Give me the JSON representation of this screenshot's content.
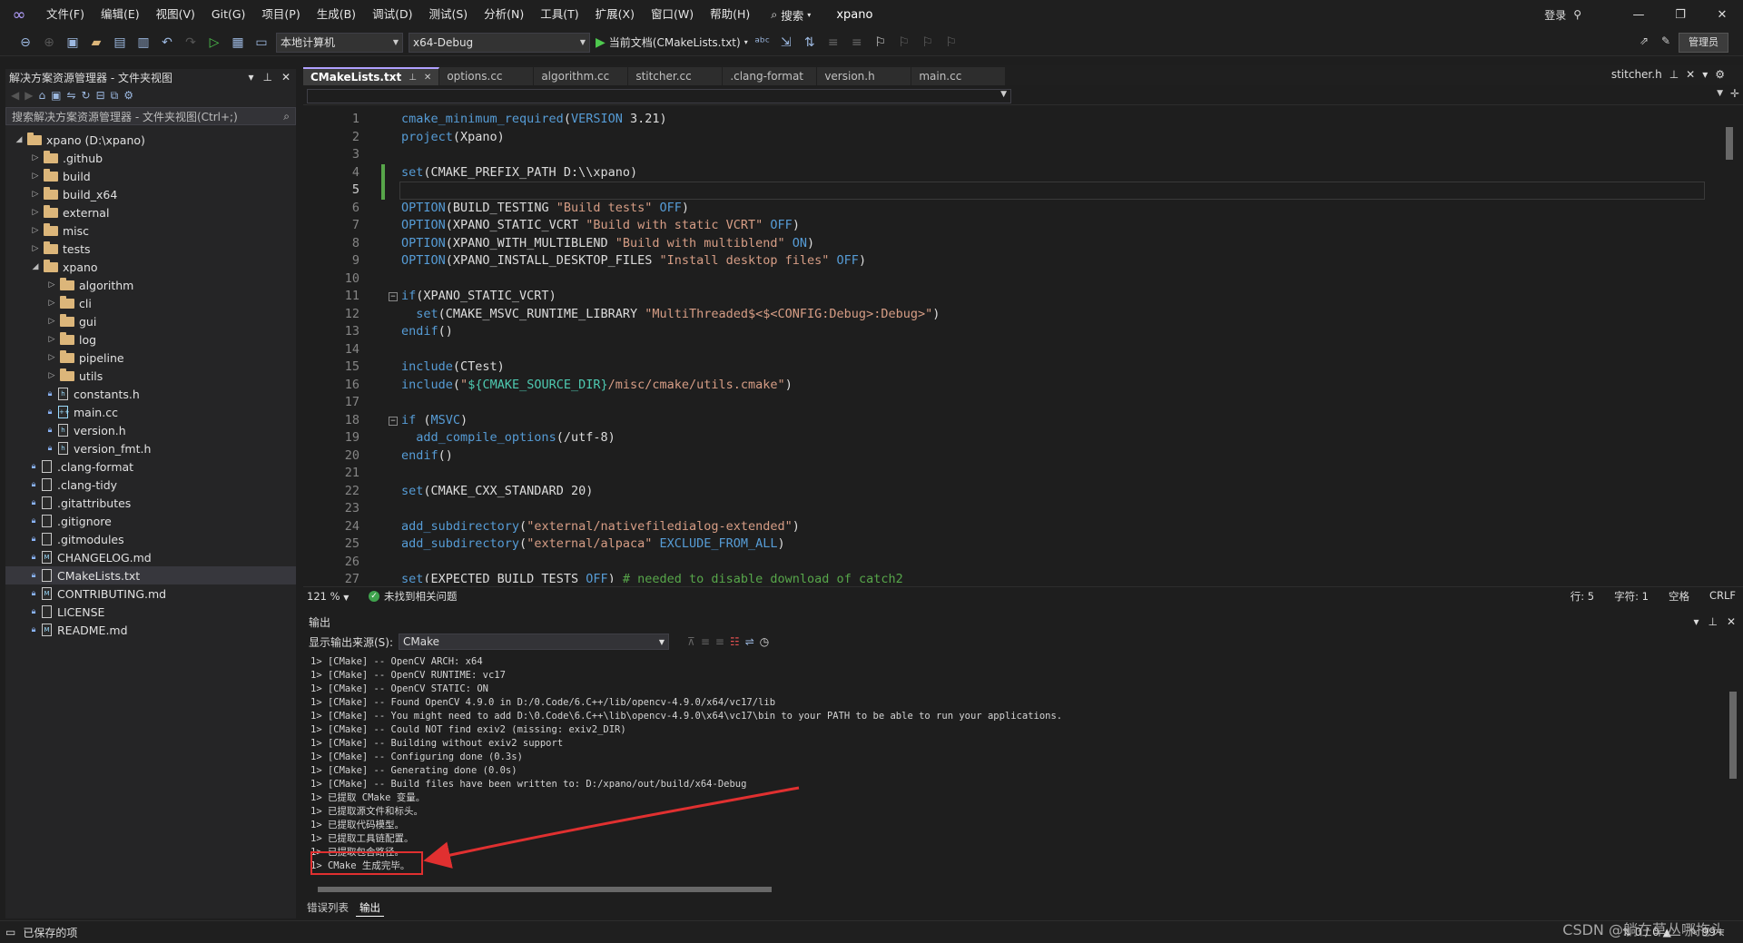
{
  "app": {
    "title": "xpano",
    "login": "登录",
    "admin": "管理员"
  },
  "menu": [
    "文件(F)",
    "编辑(E)",
    "视图(V)",
    "Git(G)",
    "项目(P)",
    "生成(B)",
    "调试(D)",
    "测试(S)",
    "分析(N)",
    "工具(T)",
    "扩展(X)",
    "窗口(W)",
    "帮助(H)"
  ],
  "search_label": "搜索",
  "toolbar": {
    "target": "本地计算机",
    "config": "x64-Debug",
    "run": "当前文档(CMakeLists.txt)"
  },
  "solution": {
    "title": "解决方案资源管理器 - 文件夹视图",
    "search_placeholder": "搜索解决方案资源管理器 - 文件夹视图(Ctrl+;)",
    "items": [
      {
        "label": "xpano (D:\\xpano)",
        "depth": 0,
        "type": "folder",
        "open": true
      },
      {
        "label": ".github",
        "depth": 1,
        "type": "folder"
      },
      {
        "label": "build",
        "depth": 1,
        "type": "folder"
      },
      {
        "label": "build_x64",
        "depth": 1,
        "type": "folder"
      },
      {
        "label": "external",
        "depth": 1,
        "type": "folder"
      },
      {
        "label": "misc",
        "depth": 1,
        "type": "folder"
      },
      {
        "label": "tests",
        "depth": 1,
        "type": "folder"
      },
      {
        "label": "xpano",
        "depth": 1,
        "type": "folder",
        "open": true
      },
      {
        "label": "algorithm",
        "depth": 2,
        "type": "folder"
      },
      {
        "label": "cli",
        "depth": 2,
        "type": "folder"
      },
      {
        "label": "gui",
        "depth": 2,
        "type": "folder"
      },
      {
        "label": "log",
        "depth": 2,
        "type": "folder"
      },
      {
        "label": "pipeline",
        "depth": 2,
        "type": "folder"
      },
      {
        "label": "utils",
        "depth": 2,
        "type": "folder"
      },
      {
        "label": "constants.h",
        "depth": 2,
        "type": "h"
      },
      {
        "label": "main.cc",
        "depth": 2,
        "type": "cc"
      },
      {
        "label": "version.h",
        "depth": 2,
        "type": "h"
      },
      {
        "label": "version_fmt.h",
        "depth": 2,
        "type": "h"
      },
      {
        "label": ".clang-format",
        "depth": 1,
        "type": "file"
      },
      {
        "label": ".clang-tidy",
        "depth": 1,
        "type": "file"
      },
      {
        "label": ".gitattributes",
        "depth": 1,
        "type": "file"
      },
      {
        "label": ".gitignore",
        "depth": 1,
        "type": "file"
      },
      {
        "label": ".gitmodules",
        "depth": 1,
        "type": "file"
      },
      {
        "label": "CHANGELOG.md",
        "depth": 1,
        "type": "md"
      },
      {
        "label": "CMakeLists.txt",
        "depth": 1,
        "type": "file",
        "selected": true
      },
      {
        "label": "CONTRIBUTING.md",
        "depth": 1,
        "type": "md"
      },
      {
        "label": "LICENSE",
        "depth": 1,
        "type": "file"
      },
      {
        "label": "README.md",
        "depth": 1,
        "type": "md"
      }
    ]
  },
  "editor": {
    "tabs": [
      "CMakeLists.txt",
      "options.cc",
      "algorithm.cc",
      "stitcher.cc",
      ".clang-format",
      "version.h",
      "main.cc"
    ],
    "right_tab": "stitcher.h",
    "current_line": 5,
    "lines": [
      {
        "n": 1,
        "parts": [
          [
            "cmd",
            "cmake_minimum_required"
          ],
          [
            "v",
            "("
          ],
          [
            "k",
            "VERSION"
          ],
          [
            "v",
            " 3.21)"
          ]
        ]
      },
      {
        "n": 2,
        "parts": [
          [
            "cmd",
            "project"
          ],
          [
            "v",
            "(Xpano)"
          ]
        ]
      },
      {
        "n": 3,
        "parts": []
      },
      {
        "n": 4,
        "parts": [
          [
            "cmd",
            "set"
          ],
          [
            "v",
            "(CMAKE_PREFIX_PATH D:\\\\xpano)"
          ]
        ]
      },
      {
        "n": 5,
        "parts": []
      },
      {
        "n": 6,
        "parts": [
          [
            "cmd",
            "OPTION"
          ],
          [
            "v",
            "(BUILD_TESTING "
          ],
          [
            "s",
            "\"Build tests\""
          ],
          [
            "k",
            " OFF"
          ],
          [
            "v",
            ")"
          ]
        ]
      },
      {
        "n": 7,
        "parts": [
          [
            "cmd",
            "OPTION"
          ],
          [
            "v",
            "(XPANO_STATIC_VCRT "
          ],
          [
            "s",
            "\"Build with static VCRT\""
          ],
          [
            "k",
            " OFF"
          ],
          [
            "v",
            ")"
          ]
        ]
      },
      {
        "n": 8,
        "parts": [
          [
            "cmd",
            "OPTION"
          ],
          [
            "v",
            "(XPANO_WITH_MULTIBLEND "
          ],
          [
            "s",
            "\"Build with multiblend\""
          ],
          [
            "k",
            " ON"
          ],
          [
            "v",
            ")"
          ]
        ]
      },
      {
        "n": 9,
        "parts": [
          [
            "cmd",
            "OPTION"
          ],
          [
            "v",
            "(XPANO_INSTALL_DESKTOP_FILES "
          ],
          [
            "s",
            "\"Install desktop files\""
          ],
          [
            "k",
            " OFF"
          ],
          [
            "v",
            ")"
          ]
        ]
      },
      {
        "n": 10,
        "parts": []
      },
      {
        "n": 11,
        "parts": [
          [
            "cmd",
            "if"
          ],
          [
            "v",
            "(XPANO_STATIC_VCRT)"
          ]
        ],
        "fold": true
      },
      {
        "n": 12,
        "parts": [
          [
            "v",
            "  "
          ],
          [
            "cmd",
            "set"
          ],
          [
            "v",
            "(CMAKE_MSVC_RUNTIME_LIBRARY "
          ],
          [
            "s",
            "\"MultiThreaded$<$<CONFIG:Debug>:Debug>\""
          ],
          [
            "v",
            ")"
          ]
        ]
      },
      {
        "n": 13,
        "parts": [
          [
            "cmd",
            "endif"
          ],
          [
            "v",
            "()"
          ]
        ]
      },
      {
        "n": 14,
        "parts": []
      },
      {
        "n": 15,
        "parts": [
          [
            "cmd",
            "include"
          ],
          [
            "v",
            "(CTest)"
          ]
        ]
      },
      {
        "n": 16,
        "parts": [
          [
            "cmd",
            "include"
          ],
          [
            "v",
            "("
          ],
          [
            "s",
            "\""
          ],
          [
            "var",
            "${CMAKE_SOURCE_DIR}"
          ],
          [
            "s",
            "/misc/cmake/utils.cmake\""
          ],
          [
            "v",
            ")"
          ]
        ]
      },
      {
        "n": 17,
        "parts": []
      },
      {
        "n": 18,
        "parts": [
          [
            "cmd",
            "if"
          ],
          [
            "v",
            " ("
          ],
          [
            "k",
            "MSVC"
          ],
          [
            "v",
            ")"
          ]
        ],
        "fold": true
      },
      {
        "n": 19,
        "parts": [
          [
            "v",
            "  "
          ],
          [
            "cmd",
            "add_compile_options"
          ],
          [
            "v",
            "(/utf-8)"
          ]
        ]
      },
      {
        "n": 20,
        "parts": [
          [
            "cmd",
            "endif"
          ],
          [
            "v",
            "()"
          ]
        ]
      },
      {
        "n": 21,
        "parts": []
      },
      {
        "n": 22,
        "parts": [
          [
            "cmd",
            "set"
          ],
          [
            "v",
            "(CMAKE_CXX_STANDARD 20)"
          ]
        ]
      },
      {
        "n": 23,
        "parts": []
      },
      {
        "n": 24,
        "parts": [
          [
            "cmd",
            "add_subdirectory"
          ],
          [
            "v",
            "("
          ],
          [
            "s",
            "\"external/nativefiledialog-extended\""
          ],
          [
            "v",
            ")"
          ]
        ]
      },
      {
        "n": 25,
        "parts": [
          [
            "cmd",
            "add_subdirectory"
          ],
          [
            "v",
            "("
          ],
          [
            "s",
            "\"external/alpaca\""
          ],
          [
            "k",
            " EXCLUDE_FROM_ALL"
          ],
          [
            "v",
            ")"
          ]
        ]
      },
      {
        "n": 26,
        "parts": []
      },
      {
        "n": 27,
        "parts": [
          [
            "cmd",
            "set"
          ],
          [
            "v",
            "(EXPECTED_BUILD_TESTS "
          ],
          [
            "k",
            "OFF"
          ],
          [
            "v",
            ") "
          ],
          [
            "c",
            "# needed to disable download of catch2"
          ]
        ]
      }
    ]
  },
  "editor_status": {
    "zoom": "121 %",
    "issues": "未找到相关问题",
    "line": "行: 5",
    "char": "字符: 1",
    "indent": "空格",
    "eol": "CRLF"
  },
  "output": {
    "title": "输出",
    "source_label": "显示输出来源(S):",
    "source": "CMake",
    "lines": [
      "1> [CMake] -- OpenCV ARCH: x64",
      "1> [CMake] -- OpenCV RUNTIME: vc17",
      "1> [CMake] -- OpenCV STATIC: ON",
      "1> [CMake] -- Found OpenCV 4.9.0 in D:/0.Code/6.C++/lib/opencv-4.9.0/x64/vc17/lib",
      "1> [CMake] -- You might need to add D:\\0.Code\\6.C++\\lib\\opencv-4.9.0\\x64\\vc17\\bin to your PATH to be able to run your applications.",
      "1> [CMake] -- Could NOT find exiv2 (missing: exiv2_DIR)",
      "1> [CMake] -- Building without exiv2 support",
      "1> [CMake] -- Configuring done (0.3s)",
      "1> [CMake] -- Generating done (0.0s)",
      "1> [CMake] -- Build files have been written to: D:/xpano/out/build/x64-Debug",
      "1> 已提取 CMake 变量。",
      "1> 已提取源文件和标头。",
      "1> 已提取代码模型。",
      "1> 已提取工具链配置。",
      "1> 已提取包含路径。",
      "1> CMake 生成完毕。"
    ]
  },
  "bottom_tabs": [
    "错误列表",
    "输出"
  ],
  "status": {
    "saved": "已保存的项",
    "git": "0 / 0",
    "notifications": "99+"
  },
  "watermark": "CSDN @躺在草丛哪拖头"
}
